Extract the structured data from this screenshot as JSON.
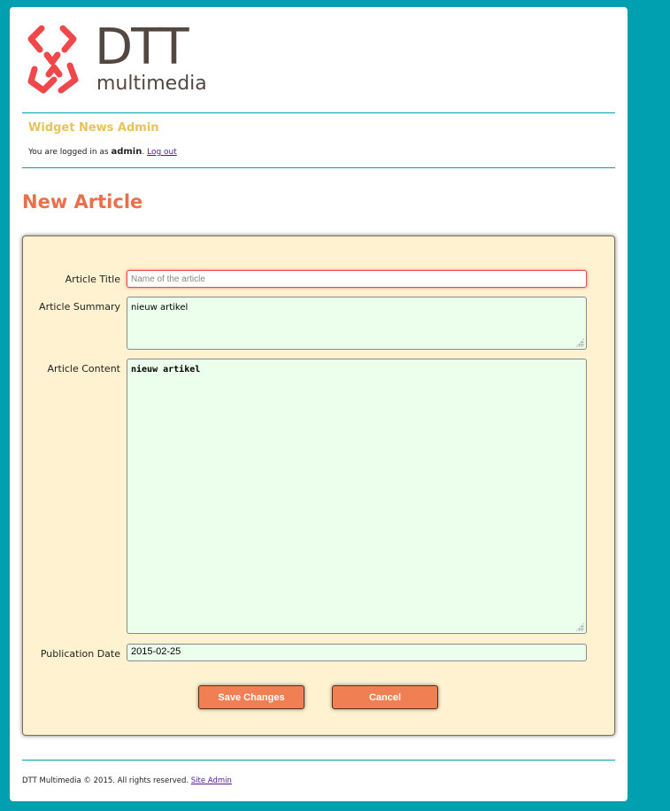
{
  "logo": {
    "text": "DTT",
    "subtext": "multimedia",
    "accent_color": "#f0474a"
  },
  "header": {
    "admin_title": "Widget News Admin",
    "login_prefix": "You are logged in as",
    "username": "admin",
    "login_suffix": ".",
    "logout_label": "Log out"
  },
  "page": {
    "title": "New Article"
  },
  "form": {
    "title_label": "Article Title",
    "title_placeholder": "Name of the article",
    "title_value": "",
    "summary_label": "Article Summary",
    "summary_value": "nieuw artikel",
    "content_label": "Article Content",
    "content_value": "nieuw artikel",
    "date_label": "Publication Date",
    "date_value": "2015-02-25",
    "save_label": "Save Changes",
    "cancel_label": "Cancel"
  },
  "footer": {
    "copyright": "DTT Multimedia © 2015. All rights reserved.",
    "site_admin_label": "Site Admin"
  },
  "colors": {
    "background": "#00a0b0",
    "heading": "#e9704a",
    "admin_title": "#e7c45a",
    "panel": "#fff2d0",
    "field": "#ecffec",
    "button": "#f07f53"
  }
}
